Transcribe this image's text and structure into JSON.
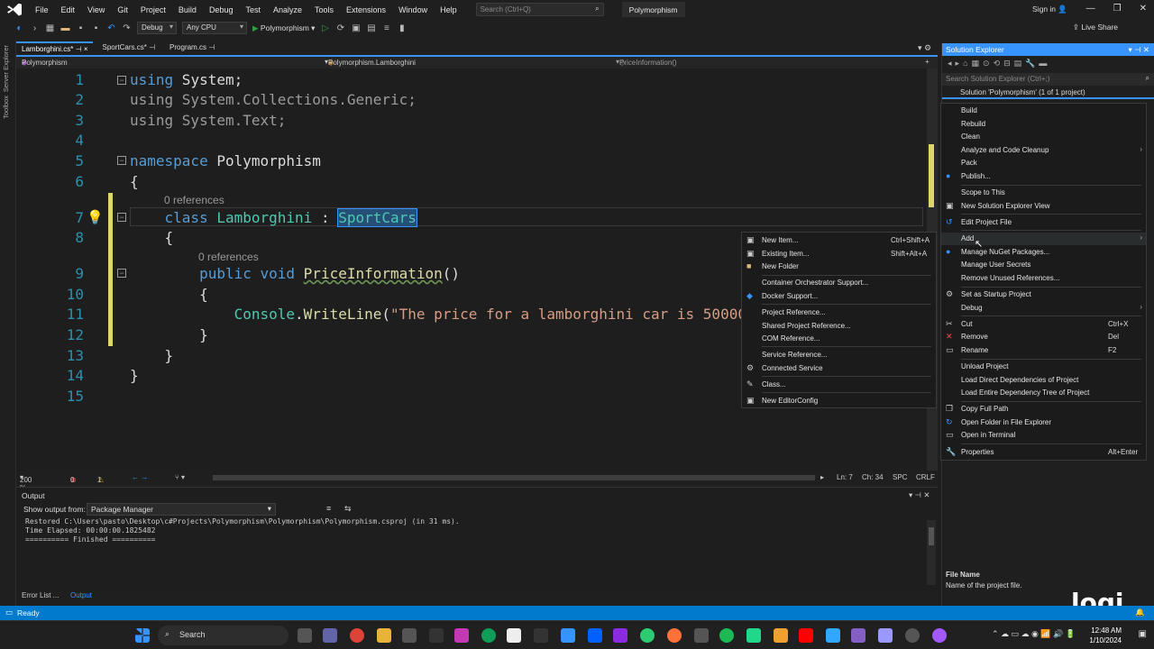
{
  "menu": {
    "items": [
      "File",
      "Edit",
      "View",
      "Git",
      "Project",
      "Build",
      "Debug",
      "Test",
      "Analyze",
      "Tools",
      "Extensions",
      "Window",
      "Help"
    ],
    "search_placeholder": "Search (Ctrl+Q)",
    "solution_name": "Polymorphism",
    "signin": "Sign in",
    "liveshare": "Live Share"
  },
  "toolbar": {
    "config": "Debug",
    "platform": "Any CPU",
    "run_label": "Polymorphism"
  },
  "leftstrip": {
    "server_explorer": "Server Explorer",
    "toolbox": "Toolbox"
  },
  "tabs": [
    {
      "label": "Lamborghini.cs*"
    },
    {
      "label": "SportCars.cs*"
    },
    {
      "label": "Program.cs"
    }
  ],
  "navbar": {
    "project": "Polymorphism",
    "type": "Polymorphism.Lamborghini",
    "member": "PriceInformation()"
  },
  "editor": {
    "line_numbers": [
      "1",
      "2",
      "3",
      "4",
      "5",
      "6",
      "7",
      "8",
      "9",
      "10",
      "11",
      "12",
      "13",
      "14",
      "15"
    ],
    "references": "0 references",
    "references2": "0 references"
  },
  "statusline": {
    "zoom": "200 %",
    "errors": "0",
    "warnings": "1",
    "ln": "Ln: 7",
    "ch": "Ch: 34",
    "spc": "SPC",
    "crlf": "CRLF"
  },
  "output": {
    "title": "Output",
    "show_from": "Show output from:",
    "source": "Package Manager",
    "lines": "Restored C:\\Users\\pasto\\Desktop\\c#Projects\\Polymorphism\\Polymorphism\\Polymorphism.csproj (in 31 ms).\nTime Elapsed: 00:00:00.1825482\n========== Finished =========="
  },
  "bottomtabs": {
    "error_list": "Error List ...",
    "output": "Output"
  },
  "solution_explorer": {
    "title": "Solution Explorer",
    "search_placeholder": "Search Solution Explorer (Ctrl+;)",
    "solution": "Solution 'Polymorphism' (1 of 1 project)",
    "footer_title": "File Name",
    "footer_desc": "Name of the project file."
  },
  "context_menu": [
    {
      "label": "Build",
      "shortcut": "",
      "icon": ""
    },
    {
      "label": "Rebuild",
      "shortcut": "",
      "icon": ""
    },
    {
      "label": "Clean",
      "shortcut": "",
      "icon": ""
    },
    {
      "label": "Analyze and Code Cleanup",
      "shortcut": "",
      "icon": "",
      "arrow": "›"
    },
    {
      "label": "Pack",
      "shortcut": "",
      "icon": ""
    },
    {
      "label": "Publish...",
      "shortcut": "",
      "icon": "●"
    },
    {
      "label": "Scope to This",
      "shortcut": "",
      "icon": ""
    },
    {
      "label": "New Solution Explorer View",
      "shortcut": "",
      "icon": "▣"
    },
    {
      "label": "Edit Project File",
      "shortcut": "",
      "icon": "↺"
    },
    {
      "label": "Add",
      "shortcut": "",
      "icon": "",
      "arrow": "›"
    },
    {
      "label": "Manage NuGet Packages...",
      "shortcut": "",
      "icon": "●"
    },
    {
      "label": "Manage User Secrets",
      "shortcut": "",
      "icon": ""
    },
    {
      "label": "Remove Unused References...",
      "shortcut": "",
      "icon": ""
    },
    {
      "label": "Set as Startup Project",
      "shortcut": "",
      "icon": "⚙"
    },
    {
      "label": "Debug",
      "shortcut": "",
      "icon": "",
      "arrow": "›"
    },
    {
      "label": "Cut",
      "shortcut": "Ctrl+X",
      "icon": "✂"
    },
    {
      "label": "Remove",
      "shortcut": "Del",
      "icon": "✕"
    },
    {
      "label": "Rename",
      "shortcut": "F2",
      "icon": "▭"
    },
    {
      "label": "Unload Project",
      "shortcut": "",
      "icon": ""
    },
    {
      "label": "Load Direct Dependencies of Project",
      "shortcut": "",
      "icon": ""
    },
    {
      "label": "Load Entire Dependency Tree of Project",
      "shortcut": "",
      "icon": ""
    },
    {
      "label": "Copy Full Path",
      "shortcut": "",
      "icon": "❐"
    },
    {
      "label": "Open Folder in File Explorer",
      "shortcut": "",
      "icon": "↻"
    },
    {
      "label": "Open in Terminal",
      "shortcut": "",
      "icon": "▭"
    },
    {
      "label": "Properties",
      "shortcut": "Alt+Enter",
      "icon": "🔧"
    }
  ],
  "add_submenu": [
    {
      "label": "New Item...",
      "shortcut": "Ctrl+Shift+A",
      "icon": "▣"
    },
    {
      "label": "Existing Item...",
      "shortcut": "Shift+Alt+A",
      "icon": "▣"
    },
    {
      "label": "New Folder",
      "shortcut": "",
      "icon": "■"
    },
    {
      "label": "Container Orchestrator Support...",
      "shortcut": "",
      "icon": ""
    },
    {
      "label": "Docker Support...",
      "shortcut": "",
      "icon": "◆"
    },
    {
      "label": "Project Reference...",
      "shortcut": "",
      "icon": ""
    },
    {
      "label": "Shared Project Reference...",
      "shortcut": "",
      "icon": ""
    },
    {
      "label": "COM Reference...",
      "shortcut": "",
      "icon": ""
    },
    {
      "label": "Service Reference...",
      "shortcut": "",
      "icon": ""
    },
    {
      "label": "Connected Service",
      "shortcut": "",
      "icon": "⚙"
    },
    {
      "label": "Class...",
      "shortcut": "",
      "icon": "✎"
    },
    {
      "label": "New EditorConfig",
      "shortcut": "",
      "icon": "▣"
    }
  ],
  "statusbar": {
    "ready": "Ready"
  },
  "taskbar": {
    "search": "Search",
    "time": "12:48 AM",
    "date": "1/10/2024"
  },
  "branding": {
    "logo_text": "logi"
  }
}
